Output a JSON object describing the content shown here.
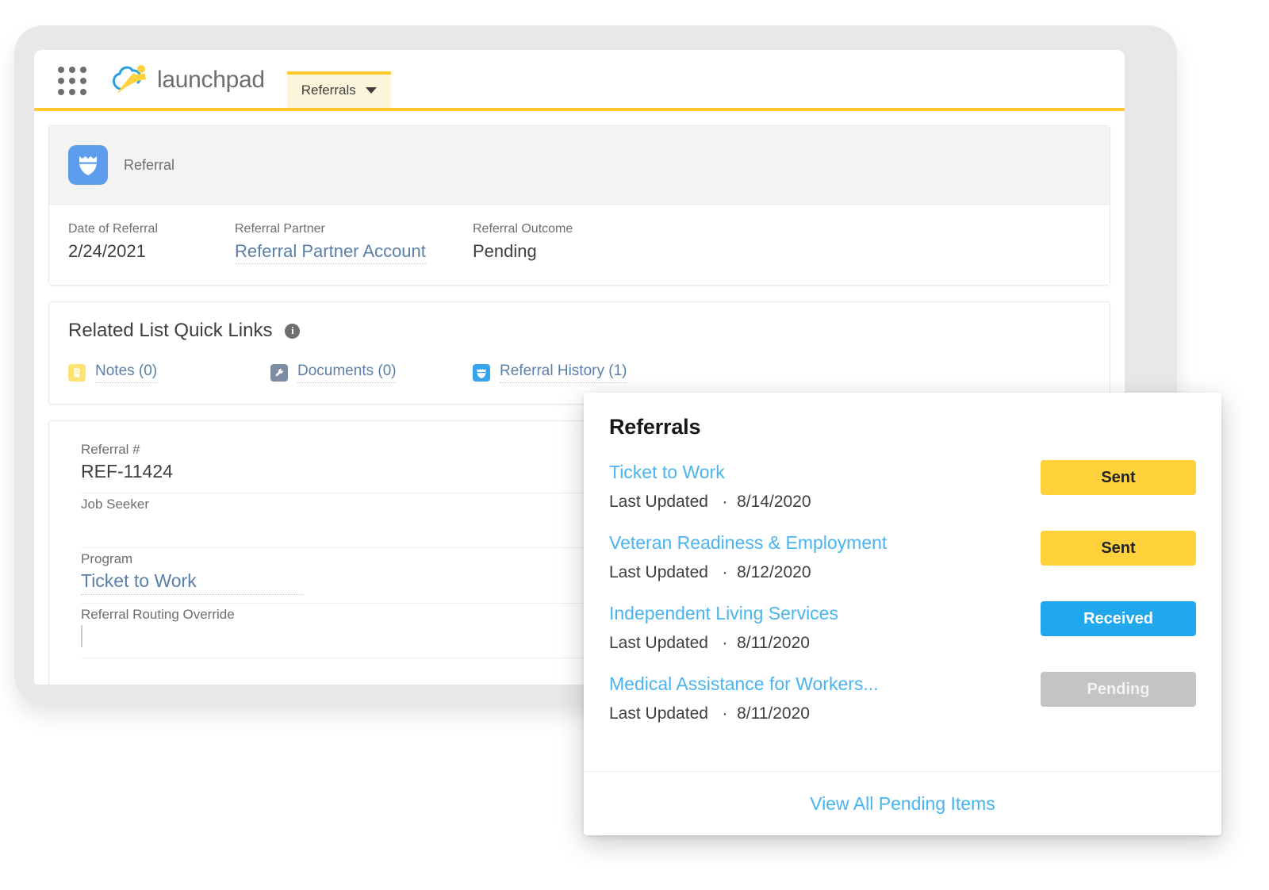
{
  "header": {
    "app_launcher_icon": "app-grid-icon",
    "brand_name": "launchpad",
    "brand_logo_icon": "launchpad-logo-icon",
    "tab_label": "Referrals",
    "tab_chevron_icon": "chevron-down-icon"
  },
  "record": {
    "type_icon": "referral-shield-icon",
    "type_label": "Referral",
    "fields": [
      {
        "label": "Date of Referral",
        "value": "2/24/2021",
        "is_link": false
      },
      {
        "label": "Referral Partner",
        "value": "Referral Partner Account",
        "is_link": true
      },
      {
        "label": "Referral Outcome",
        "value": "Pending",
        "is_link": false
      }
    ]
  },
  "quick_links": {
    "title": "Related List Quick Links",
    "info_icon": "info-icon",
    "items": [
      {
        "label": "Notes (0)",
        "icon": "notes-icon"
      },
      {
        "label": "Documents (0)",
        "icon": "wrench-document-icon"
      },
      {
        "label": "Referral History (1)",
        "icon": "referral-shield-icon"
      }
    ]
  },
  "detail_form": {
    "rows": [
      {
        "label": "Referral #",
        "value": "REF-11424",
        "kind": "text",
        "editable": false
      },
      {
        "label": "Job Seeker",
        "value": "",
        "kind": "text",
        "editable": true
      },
      {
        "label": "Program",
        "value": "Ticket to Work",
        "kind": "link",
        "editable": true
      },
      {
        "label": "Referral Routing Override",
        "value": "",
        "kind": "checkbox",
        "editable": true
      }
    ],
    "edit_icon": "pencil-icon"
  },
  "referrals_panel": {
    "title": "Referrals",
    "updated_prefix": "Last Updated",
    "separator": "·",
    "items": [
      {
        "name": "Ticket to Work",
        "updated_label": "Last Updated   ·  8/14/2020",
        "date": "8/14/2020",
        "status": "Sent",
        "status_color": "#ffd13b"
      },
      {
        "name": "Veteran Readiness & Employment",
        "updated_label": "Last Updated   ·  8/12/2020",
        "date": "8/12/2020",
        "status": "Sent",
        "status_color": "#ffd13b"
      },
      {
        "name": "Independent Living Services",
        "updated_label": "Last Updated   ·  8/11/2020",
        "date": "8/11/2020",
        "status": "Received",
        "status_color": "#21a8ec"
      },
      {
        "name": "Medical Assistance for Workers...",
        "updated_label": "Last Updated   ·  8/11/2020",
        "date": "8/11/2020",
        "status": "Pending",
        "status_color": "#c4c4c4"
      }
    ],
    "footer_link": "View All Pending Items"
  },
  "colors": {
    "brand_yellow": "#ffc82c",
    "tab_background": "#fdf6dd",
    "link_blue": "#49b4f0",
    "record_icon_blue": "#5c9ded",
    "status_sent": "#ffd13b",
    "status_received": "#21a8ec",
    "status_pending": "#c4c4c4"
  }
}
